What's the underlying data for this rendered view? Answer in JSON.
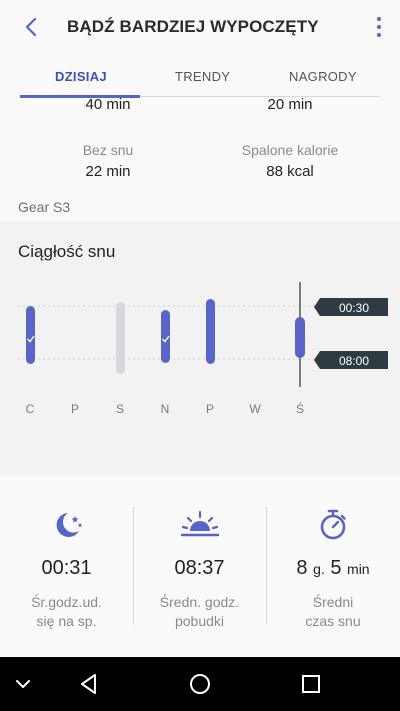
{
  "header": {
    "title": "BĄDŹ BARDZIEJ WYPOCZĘTY",
    "back_icon": "back-arrow-icon",
    "menu_icon": "more-vert-icon"
  },
  "tabs": [
    {
      "label": "DZISIAJ",
      "active": true
    },
    {
      "label": "TRENDY",
      "active": false
    },
    {
      "label": "NAGRODY",
      "active": false
    }
  ],
  "stats": {
    "top_left_value": "40 min",
    "top_right_value": "20 min",
    "awake_label": "Bez snu",
    "awake_value": "22 min",
    "calories_label": "Spalone kalorie",
    "calories_value": "88 kcal"
  },
  "device": "Gear S3",
  "consistency": {
    "title": "Ciągłość snu",
    "days": [
      "C",
      "P",
      "S",
      "N",
      "P",
      "W",
      "Ś"
    ],
    "bedtime_label": "00:30",
    "wake_label": "08:00",
    "accent": "#5964c8"
  },
  "summary": [
    {
      "icon": "moon-stars-icon",
      "value": "00:31",
      "label_line1": "Śr.godz.ud.",
      "label_line2": "się na sp."
    },
    {
      "icon": "sunrise-icon",
      "value": "08:37",
      "label_line1": "Średn. godz.",
      "label_line2": "pobudki"
    },
    {
      "icon": "stopwatch-icon",
      "value_hours": "8",
      "value_hours_unit": "g.",
      "value_minutes": "5",
      "value_minutes_unit": "min",
      "label_line1": "Średni",
      "label_line2": "czas snu"
    }
  ],
  "navbar": {
    "icons": [
      "chevron-down-icon",
      "back-triangle-icon",
      "home-circle-icon",
      "recents-square-icon"
    ]
  }
}
